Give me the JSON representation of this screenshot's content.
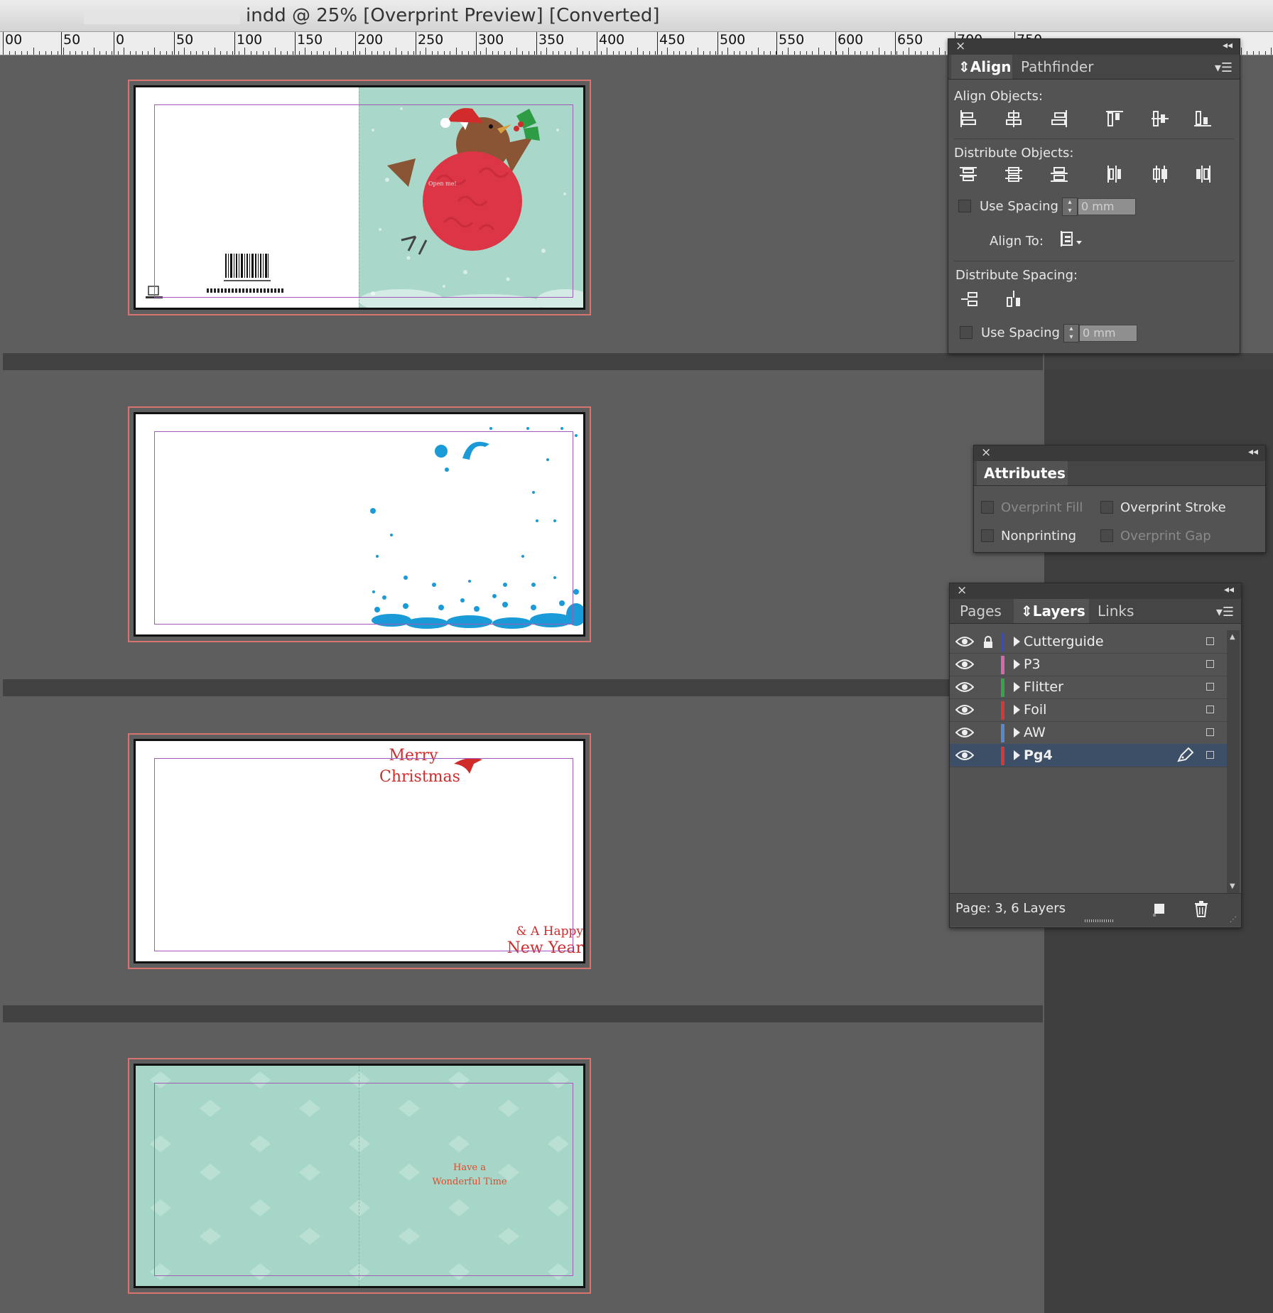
{
  "window": {
    "title": "indd @ 25% [Overprint Preview] [Converted]"
  },
  "ruler": {
    "labels": [
      "00",
      "50",
      "0",
      "50",
      "100",
      "150",
      "200",
      "250",
      "300",
      "350",
      "400",
      "450",
      "500",
      "550",
      "600",
      "650",
      "700",
      "750"
    ]
  },
  "spreads": {
    "one": {
      "barcode_caption": ""
    },
    "two": {},
    "three": {
      "greeting_line1": "Merry",
      "greeting_line2": "Christmas",
      "closing_line1": "& A Happy",
      "closing_line2": "New Year"
    },
    "four": {
      "message_line1": "Have a",
      "message_line2": "Wonderful Time"
    }
  },
  "align_panel": {
    "tabs": [
      "Align",
      "Pathfinder"
    ],
    "align_objects_label": "Align Objects:",
    "distribute_objects_label": "Distribute Objects:",
    "use_spacing_label": "Use Spacing",
    "spacing_value": "0 mm",
    "align_to_label": "Align To:",
    "distribute_spacing_label": "Distribute Spacing:",
    "use_spacing_label_2": "Use Spacing",
    "spacing_value_2": "0 mm"
  },
  "attributes_panel": {
    "tab": "Attributes",
    "overprint_fill": "Overprint Fill",
    "overprint_stroke": "Overprint Stroke",
    "nonprinting": "Nonprinting",
    "overprint_gap": "Overprint Gap"
  },
  "layers_panel": {
    "tabs": [
      "Pages",
      "Layers",
      "Links"
    ],
    "layers": [
      {
        "name": "Cutterguide",
        "color": "#3b4fa8",
        "locked": true,
        "selected": false
      },
      {
        "name": "P3",
        "color": "#d46ba8",
        "locked": false,
        "selected": false
      },
      {
        "name": "Flitter",
        "color": "#3aa24a",
        "locked": false,
        "selected": false
      },
      {
        "name": "Foil",
        "color": "#d23a3a",
        "locked": false,
        "selected": false
      },
      {
        "name": "AW",
        "color": "#5a87c8",
        "locked": false,
        "selected": false
      },
      {
        "name": "Pg4",
        "color": "#d23a3a",
        "locked": false,
        "selected": true
      }
    ],
    "status": "Page: 3, 6 Layers"
  },
  "colors": {
    "greeting_red": "#cf2b2b",
    "mint": "#a6d6c8",
    "snow_blue": "#1a9ad6",
    "robin_breast": "#dc3545",
    "robin_brown": "#8a5535"
  }
}
